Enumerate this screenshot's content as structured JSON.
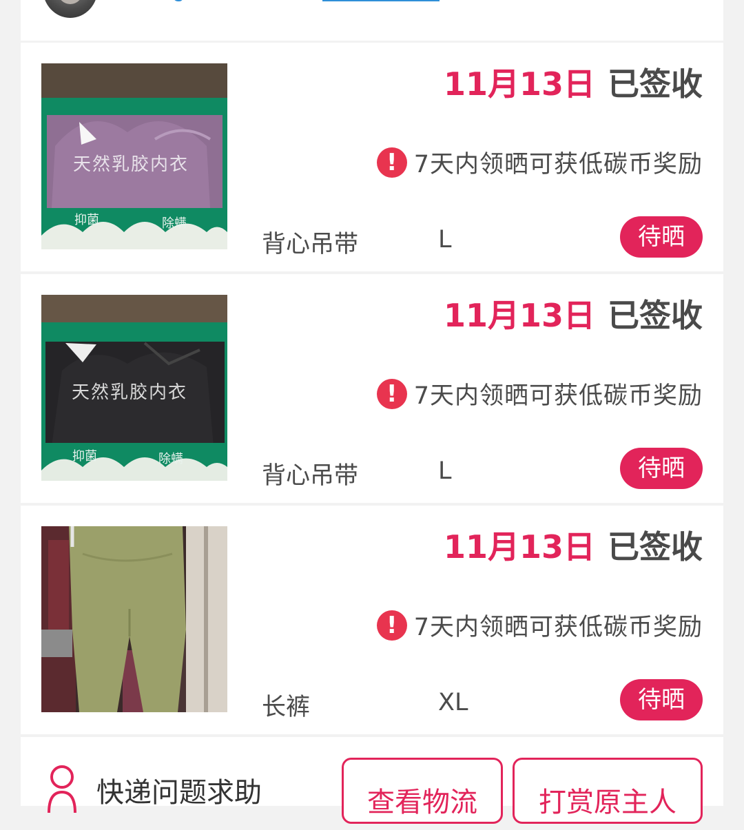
{
  "items": [
    {
      "date": "11月13日",
      "status": "已签收",
      "reward_notice": "7天内领晒可获低碳币奖励",
      "alert_icon": "!",
      "product_name": "背心吊带",
      "size": "L",
      "action_label": "待晒",
      "image": "purple-latex-bra-package"
    },
    {
      "date": "11月13日",
      "status": "已签收",
      "reward_notice": "7天内领晒可获低碳币奖励",
      "alert_icon": "!",
      "product_name": "背心吊带",
      "size": "L",
      "action_label": "待晒",
      "image": "black-latex-bra-package"
    },
    {
      "date": "11月13日",
      "status": "已签收",
      "reward_notice": "7天内领晒可获低碳币奖励",
      "alert_icon": "!",
      "product_name": "长裤",
      "size": "XL",
      "action_label": "待晒",
      "image": "olive-green-trousers"
    }
  ],
  "package_labels": {
    "title": "天然乳胶内衣",
    "left_tag": "抑菌",
    "right_tag": "除螨"
  },
  "bottom": {
    "help_label": "快递问题求助",
    "logistics_button": "查看物流",
    "tip_button": "打赏原主人"
  },
  "colors": {
    "accent": "#e2245a",
    "alert": "#e8344f",
    "link": "#2f8fd8",
    "background": "#f2f2f2"
  }
}
